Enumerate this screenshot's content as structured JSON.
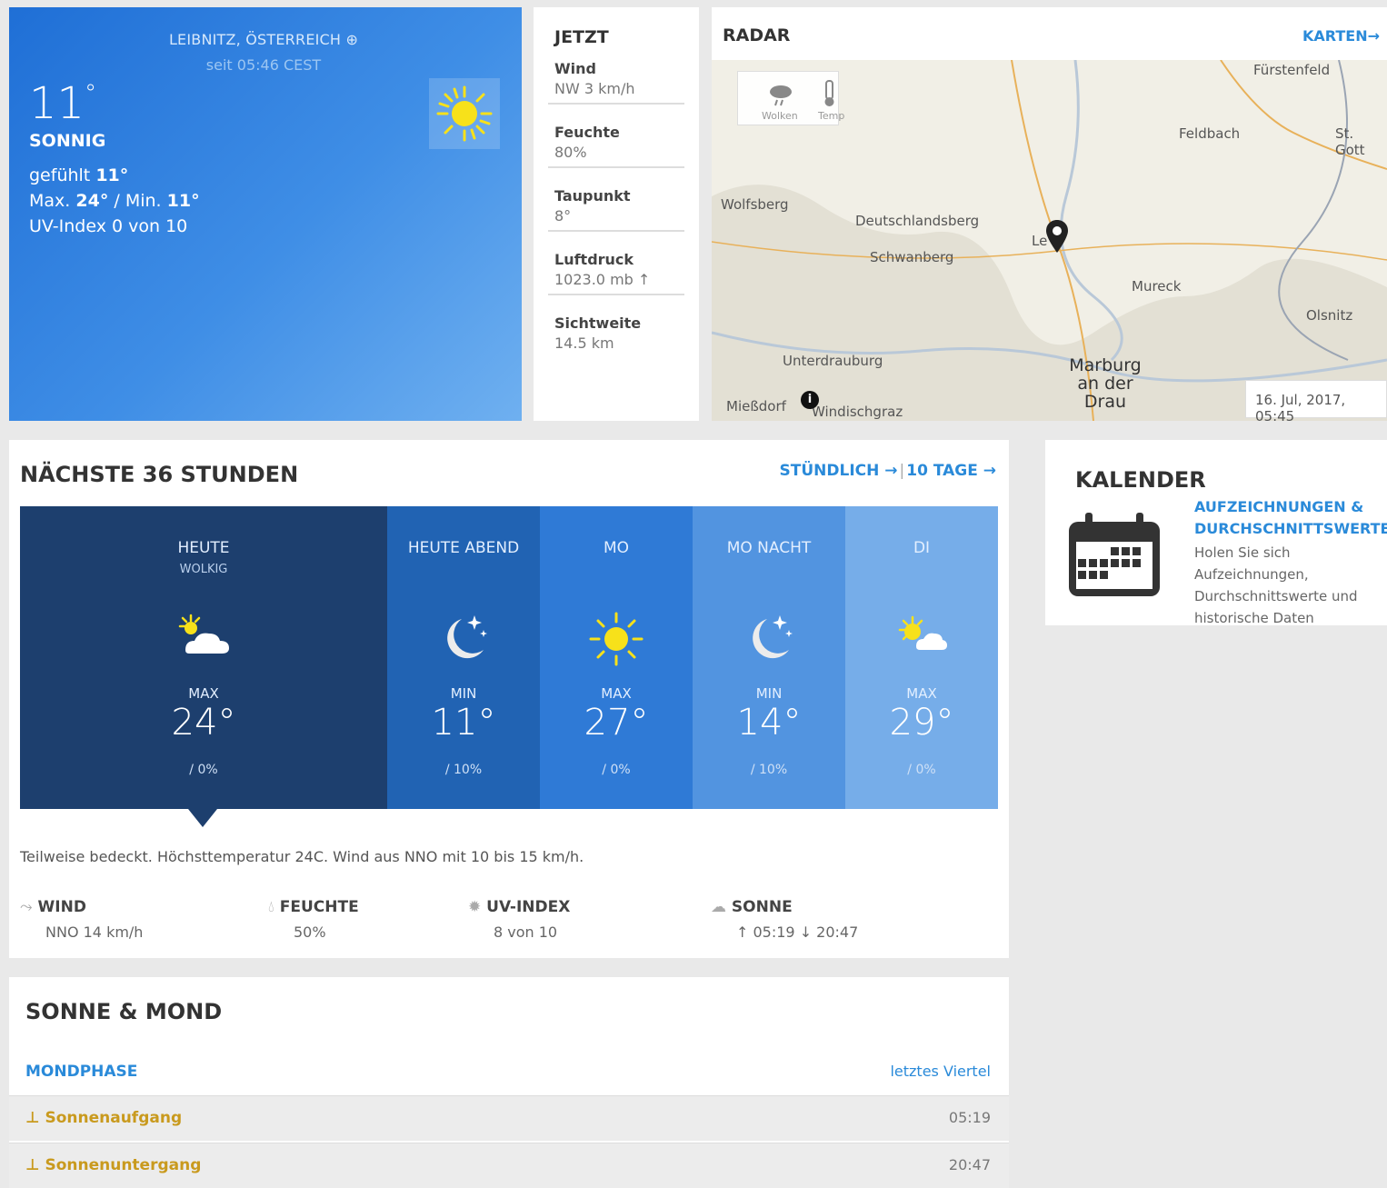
{
  "current": {
    "location": "LEIBNITZ, ÖSTERREICH",
    "since": "seit 05:46 CEST",
    "temperature": "11",
    "degree": "°",
    "condition": "SONNIG",
    "feels_label": "gefühlt",
    "feels_value": "11°",
    "max_label": "Max.",
    "max_value": "24°",
    "min_label": "Min.",
    "min_value": "11°",
    "uv": "UV-Index 0 von 10",
    "icon": "sun-icon"
  },
  "now": {
    "title": "JETZT",
    "items": [
      {
        "label": "Wind",
        "value": "NW 3 km/h"
      },
      {
        "label": "Feuchte",
        "value": "80%"
      },
      {
        "label": "Taupunkt",
        "value": "8°"
      },
      {
        "label": "Luftdruck",
        "value": "1023.0 mb ↑"
      },
      {
        "label": "Sichtweite",
        "value": "14.5 km"
      }
    ]
  },
  "radar": {
    "title": "RADAR",
    "maps_link": "KARTEN→",
    "layer_clouds": "Wolken",
    "layer_temp": "Temp",
    "timestamp": "16. Jul, 2017, 05:45",
    "places": [
      "Fürstenfeld",
      "Feldbach",
      "St. Gott",
      "Wolfsberg",
      "Deutschlandsberg",
      "Schwanberg",
      "Mureck",
      "Olsnitz",
      "Unterdrauburg",
      "Marburg an der Drau",
      "Windischgraz",
      "Mießdorf",
      "Le"
    ]
  },
  "h36": {
    "title": "NÄCHSTE 36 STUNDEN",
    "hourly_link": "STÜNDLICH →",
    "tenday_link": "10 TAGE →",
    "periods": [
      {
        "name": "HEUTE",
        "sub": "WOLKIG",
        "icon": "partly-cloudy-icon",
        "kind": "MAX",
        "temp": "24°",
        "precip": "0%",
        "bg": "#1d3f6e"
      },
      {
        "name": "HEUTE ABEND",
        "sub": "",
        "icon": "moon-icon",
        "kind": "MIN",
        "temp": "11°",
        "precip": "10%",
        "bg": "#2163b3"
      },
      {
        "name": "MO",
        "sub": "",
        "icon": "sun-icon",
        "kind": "MAX",
        "temp": "27°",
        "precip": "0%",
        "bg": "#2f7ad6"
      },
      {
        "name": "MO NACHT",
        "sub": "",
        "icon": "moon-icon",
        "kind": "MIN",
        "temp": "14°",
        "precip": "10%",
        "bg": "#5294e0"
      },
      {
        "name": "DI",
        "sub": "",
        "icon": "partly-cloudy-icon",
        "kind": "MAX",
        "temp": "29°",
        "precip": "0%",
        "bg": "#76ade9"
      }
    ],
    "narrative": "Teilweise bedeckt. Höchsttemperatur 24C. Wind aus NNO mit 10 bis 15 km/h.",
    "details": [
      {
        "label": "WIND",
        "value": "NNO 14 km/h",
        "icon": "wind-icon"
      },
      {
        "label": "FEUCHTE",
        "value": "50%",
        "icon": "humidity-icon"
      },
      {
        "label": "UV-INDEX",
        "value": "8 von 10",
        "icon": "uv-icon"
      },
      {
        "label": "SONNE",
        "value": "↑ 05:19 ↓ 20:47",
        "icon": "sunrise-icon"
      }
    ]
  },
  "calendar": {
    "title": "KALENDER",
    "link": "AUFZEICHNUNGEN & DURCHSCHNITTSWERTE",
    "description": "Holen Sie sich Aufzeichnungen, Durchschnittswerte und historische Daten"
  },
  "sun_moon": {
    "title": "SONNE & MOND",
    "moonphase_label": "MONDPHASE",
    "moonphase_value": "letztes Viertel",
    "sunrise_label": "Sonnenaufgang",
    "sunrise_value": "05:19",
    "sunset_label": "Sonnenuntergang",
    "sunset_value": "20:47"
  },
  "colors": {
    "accent": "#2a8ad9",
    "sun_gold": "#c99a1e"
  }
}
